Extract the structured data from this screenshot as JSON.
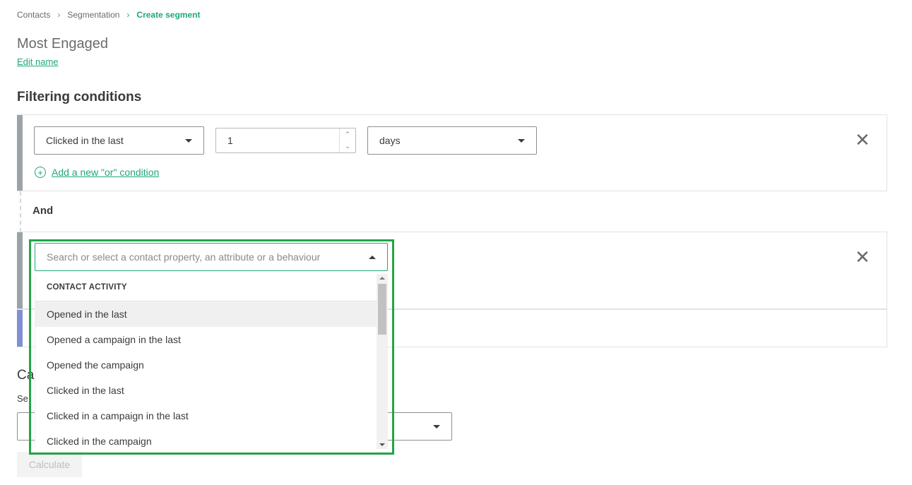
{
  "breadcrumb": {
    "items": [
      "Contacts",
      "Segmentation"
    ],
    "current": "Create segment",
    "separator": ">"
  },
  "segment": {
    "name": "Most Engaged",
    "edit_label": "Edit name"
  },
  "filters": {
    "title": "Filtering conditions",
    "condition1": {
      "type": "Clicked in the last",
      "value": "1",
      "unit": "days",
      "add_or_label": "Add a new \"or\" condition"
    },
    "joiner": "And"
  },
  "dropdown": {
    "placeholder": "Search or select a contact property, an attribute or a behaviour",
    "group_header": "CONTACT ACTIVITY",
    "options": [
      "Opened in the last",
      "Opened a campaign in the last",
      "Opened the campaign",
      "Clicked in the last",
      "Clicked in a campaign in the last",
      "Clicked in the campaign"
    ]
  },
  "calculate": {
    "button_label": "Calculate"
  },
  "colors": {
    "accent": "#1fa67a",
    "highlight": "#22a545",
    "bar_gray": "#9ba3a8",
    "bar_blue": "#7f8fd6"
  }
}
